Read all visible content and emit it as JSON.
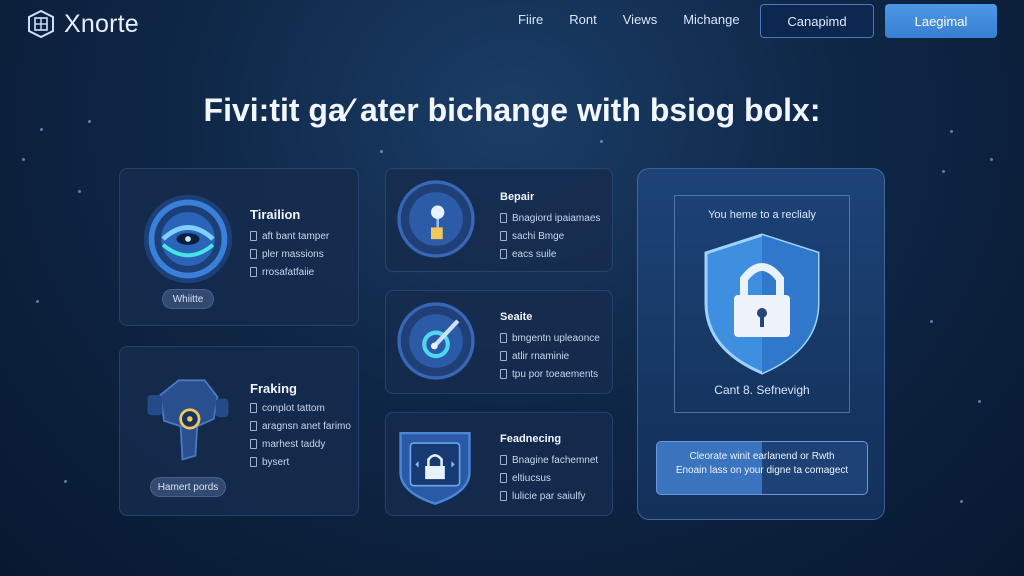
{
  "brand": {
    "name": "Xnorte"
  },
  "nav": {
    "items": [
      "Fiire",
      "Ront",
      "Views",
      "Michange"
    ]
  },
  "buttons": {
    "outline": "Canapimd",
    "primary": "Laegimal"
  },
  "headline": "Fivi:tit ga⁄ ater bichange with bsiog bolx:",
  "cards": {
    "tiration": {
      "title": "Tirailion",
      "items": [
        "aft bant tamper",
        "pler massions",
        "rrosafatfaiie"
      ],
      "pill": "Whiitte"
    },
    "fraking": {
      "title": "Fraking",
      "items": [
        "conplot tattom",
        "aragnsn anet farimo",
        "marhest taddy",
        "bysert"
      ],
      "pill": "Hamert pords"
    },
    "bepair": {
      "title": "Bepair",
      "items": [
        "Bnagiord ipaiamaes",
        "sachi Bmge",
        "eacs suile"
      ]
    },
    "seaite": {
      "title": "Seaite",
      "items": [
        "bmgentn upleaonce",
        "atlir rnaminie",
        "tpu por toeaements"
      ]
    },
    "feadnecing": {
      "title": "Feadnecing",
      "items": [
        "Bnagine fachemnet",
        "eltiucsus",
        "lulicie par saiulfy"
      ]
    }
  },
  "security": {
    "title": "You heme to a reclialy",
    "subtitle": "Cant 8. Sefnevigh",
    "message_line1": "Cleorate winit earlanend or Rwth",
    "message_line2": "Enoain lass on your digne ta comagect"
  },
  "colors": {
    "accent": "#4e97e6",
    "background": "#0f2747",
    "shield": "#3f8fe0"
  },
  "icons": [
    "logo-icon",
    "eye-icon",
    "lock-icon",
    "satellite-icon",
    "chip-icon",
    "ship-icon",
    "shield-lock-icon"
  ]
}
